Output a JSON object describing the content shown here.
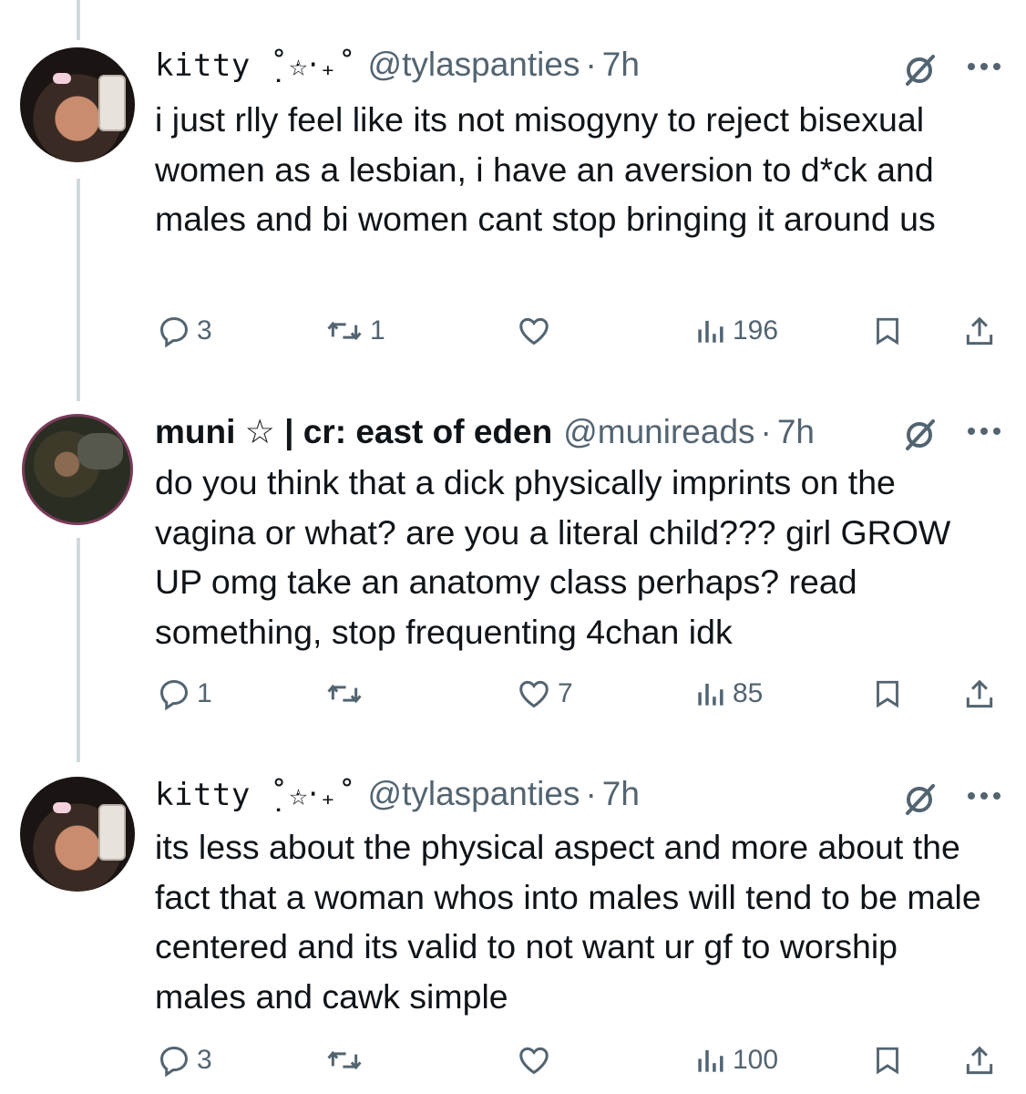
{
  "tweets": [
    {
      "display_name": "kitty ̣˚ּ☆‧₊˚",
      "handle": "@tylaspanties",
      "separator": "·",
      "time": "7h",
      "text": "i just rlly feel like its not misogyny to reject bisexual women as a lesbian, i have an aversion to d*ck and males and bi women cant stop bringing it around us",
      "replies": "3",
      "reposts": "1",
      "likes": "",
      "views": "196"
    },
    {
      "display_name": "muni ☆ | cr: east of eden",
      "handle": "@munireads",
      "separator": "·",
      "time": "7h",
      "text": "do you think that a dick physically imprints on the vagina or what? are you a literal child??? girl GROW UP omg take an anatomy class perhaps? read something, stop frequenting 4chan idk",
      "replies": "1",
      "reposts": "",
      "likes": "7",
      "views": "85"
    },
    {
      "display_name": "kitty ̣˚ּ☆‧₊˚",
      "handle": "@tylaspanties",
      "separator": "·",
      "time": "7h",
      "text": "its less about the physical aspect and more about the fact that a woman whos into males will tend to be male centered and its valid to not want ur gf to worship males and cawk simple",
      "replies": "3",
      "reposts": "",
      "likes": "",
      "views": "100"
    }
  ],
  "icons": {
    "reply": "reply-icon",
    "repost": "repost-icon",
    "like": "heart-icon",
    "views": "views-icon",
    "bookmark": "bookmark-icon",
    "share": "share-icon",
    "grok": "grok-icon",
    "more": "more-icon"
  },
  "colors": {
    "text": "#0f1419",
    "secondary": "#536471",
    "thread_line": "#cfd9de"
  }
}
